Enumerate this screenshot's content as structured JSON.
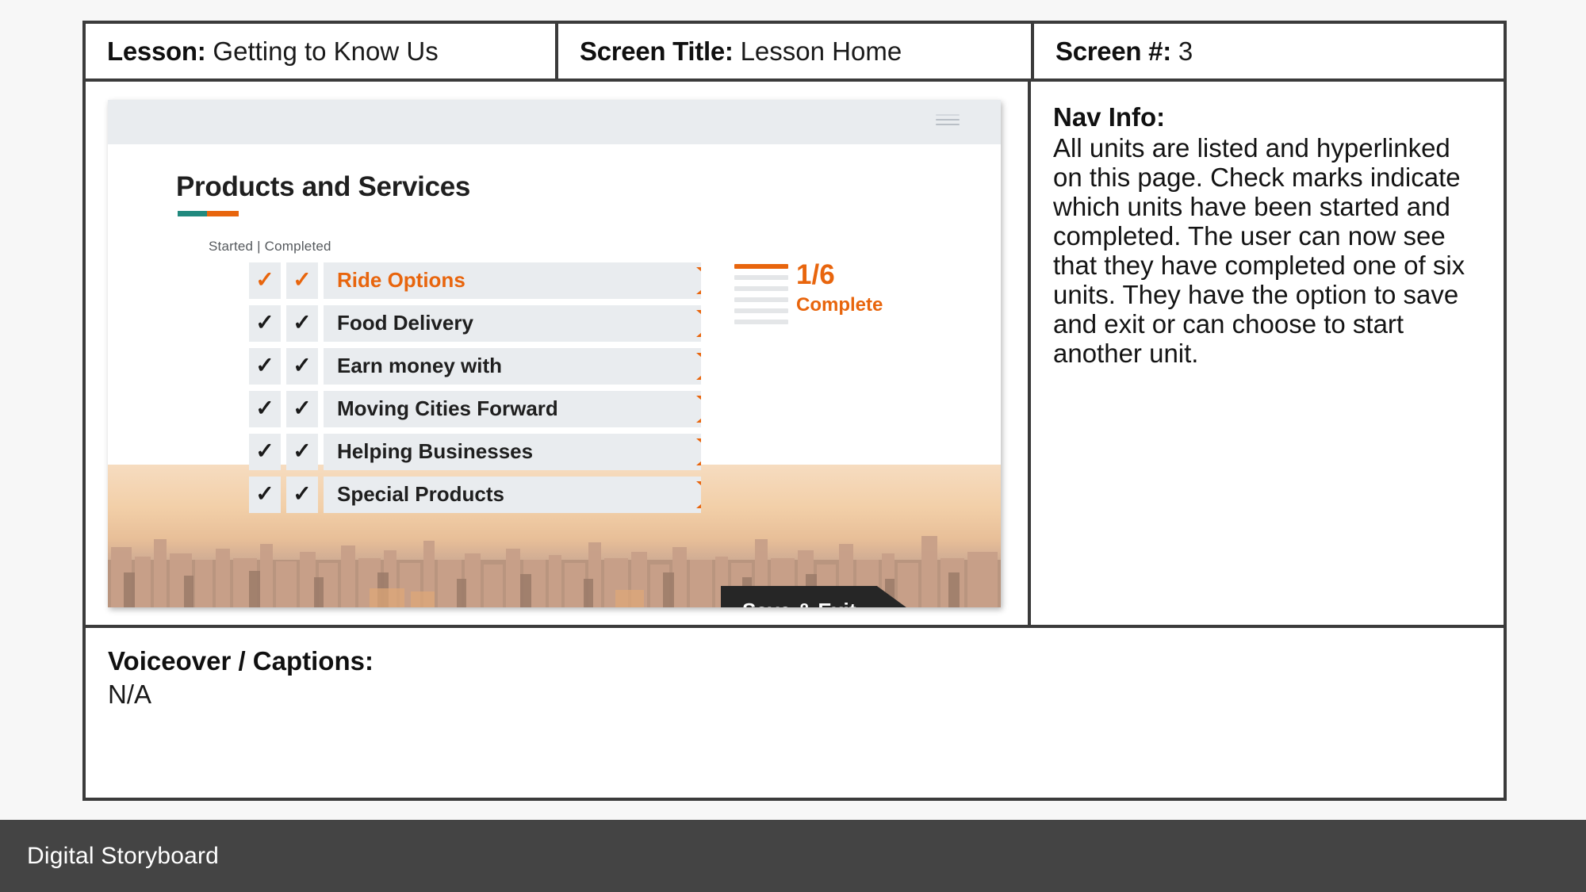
{
  "header": {
    "lesson_label": "Lesson:",
    "lesson_value": "Getting to Know Us",
    "screen_title_label": "Screen Title:",
    "screen_title_value": "Lesson Home",
    "screen_num_label": "Screen #:",
    "screen_num_value": "3"
  },
  "nav_info": {
    "title": "Nav Info:",
    "body": "All units are listed and hyperlinked on this page. Check marks indicate which units have been started and completed. The user can now see that they have completed one of six units. They have the option to save and exit or can choose to start another unit."
  },
  "voiceover": {
    "title": "Voiceover / Captions:",
    "body": "N/A"
  },
  "slide": {
    "title": "Products and Services",
    "legend": "Started | Completed",
    "menu_icon": "hamburger-icon",
    "units": [
      {
        "label": "Ride Options",
        "started": "✓",
        "completed": "✓",
        "active": true
      },
      {
        "label": "Food Delivery",
        "started": "✓",
        "completed": "✓",
        "active": false
      },
      {
        "label": "Earn money with",
        "started": "✓",
        "completed": "✓",
        "active": false
      },
      {
        "label": "Moving Cities Forward",
        "started": "✓",
        "completed": "✓",
        "active": false
      },
      {
        "label": "Helping Businesses",
        "started": "✓",
        "completed": "✓",
        "active": false
      },
      {
        "label": "Special Products",
        "started": "✓",
        "completed": "✓",
        "active": false
      }
    ],
    "progress": {
      "fraction": "1/6",
      "word": "Complete",
      "total_levels": 6,
      "filled_levels": 1
    },
    "save_exit_label": "Save & Exit"
  },
  "footer": {
    "text": "Digital Storyboard"
  },
  "colors": {
    "accent_orange": "#e8650d",
    "accent_teal": "#21897e",
    "frame": "#3b3b3b",
    "footer_bg": "#444444",
    "row_bg": "#e9ecef"
  }
}
